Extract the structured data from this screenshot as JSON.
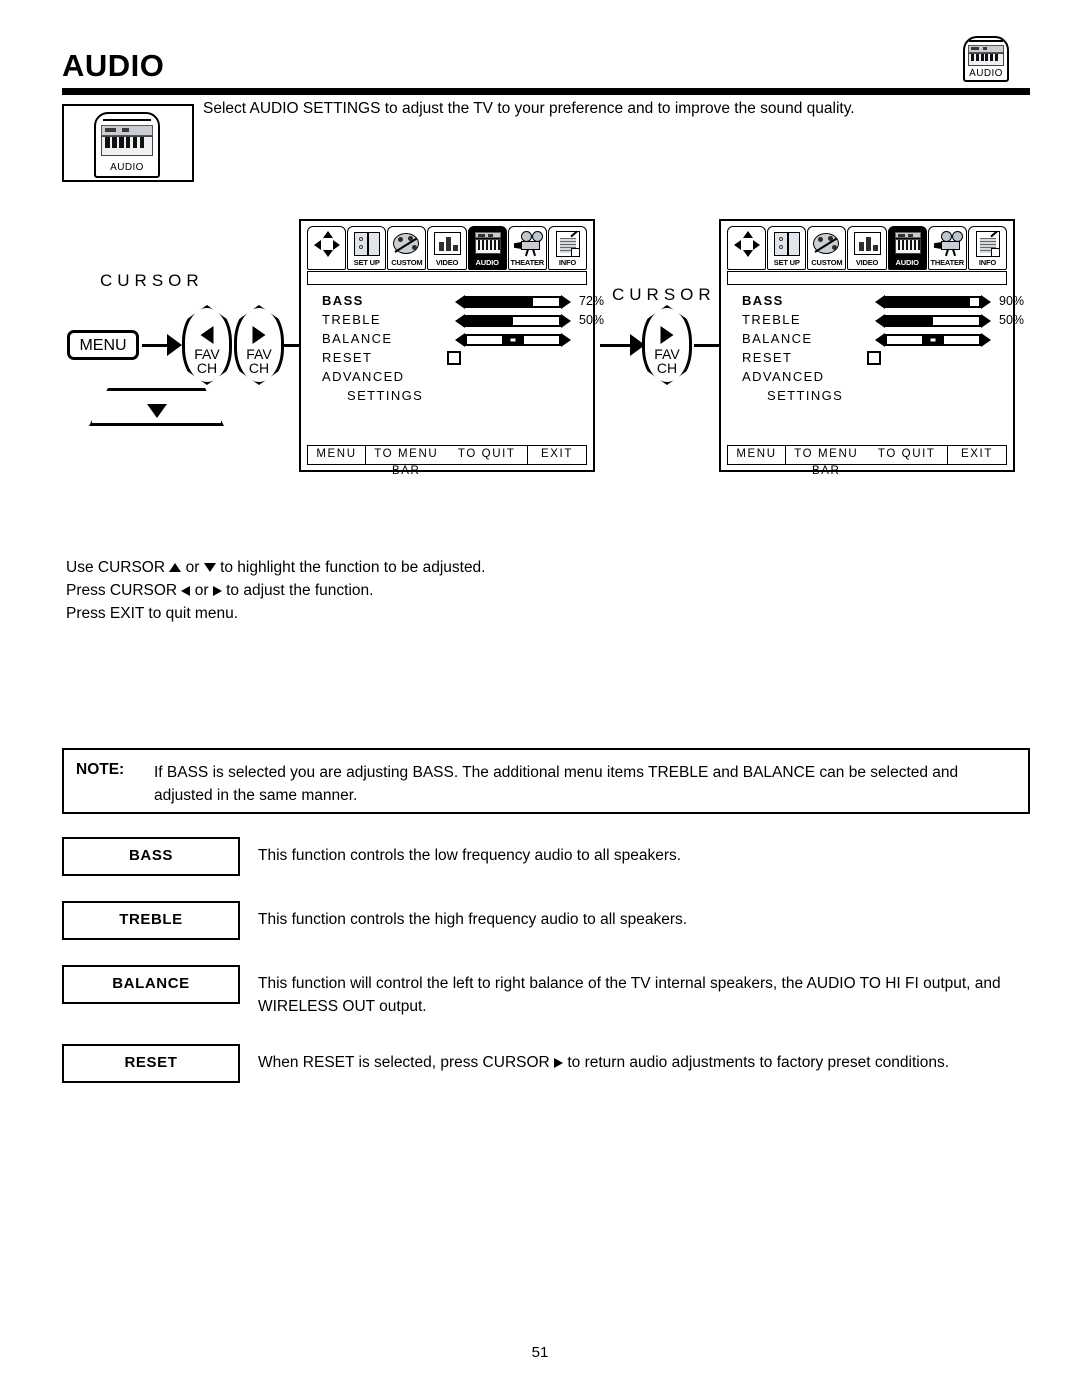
{
  "page": {
    "title": "AUDIO",
    "number": "51",
    "intro": "Select AUDIO SETTINGS to adjust the TV to your preference and to improve the sound quality.",
    "icon_label": "AUDIO"
  },
  "cursor_diagram": {
    "cursor_label_left": "CURSOR",
    "cursor_label_mid": "CURSOR",
    "menu_button": "MENU",
    "fav": "FAV",
    "ch": "CH"
  },
  "instructions": [
    {
      "pre": "Use CURSOR ",
      "icon1": "tri-up",
      "mid": " or ",
      "icon2": "tri-dn",
      "post": " to highlight the function to be adjusted."
    },
    {
      "pre": "Press CURSOR ",
      "icon1": "tri-lt",
      "mid": " or ",
      "icon2": "tri-rt",
      "post": " to adjust the function."
    },
    {
      "pre": "Press EXIT to quit menu.",
      "icon1": "",
      "mid": "",
      "icon2": "",
      "post": ""
    }
  ],
  "menu_tabs": [
    {
      "label": "",
      "icon": "cursor-pad-icon",
      "active": false
    },
    {
      "label": "SET UP",
      "icon": "setup-icon",
      "active": false
    },
    {
      "label": "CUSTOM",
      "icon": "custom-palette-icon",
      "active": false
    },
    {
      "label": "VIDEO",
      "icon": "video-icon",
      "active": false
    },
    {
      "label": "AUDIO",
      "icon": "audio-keyboard-icon",
      "active": true
    },
    {
      "label": "THEATER",
      "icon": "theater-projector-icon",
      "active": false
    },
    {
      "label": "INFO",
      "icon": "info-document-icon",
      "active": false
    }
  ],
  "osd_left": {
    "rows": [
      {
        "name": "BASS",
        "selected": true,
        "type": "slider",
        "value": 72,
        "value_label": "72%"
      },
      {
        "name": "TREBLE",
        "selected": false,
        "type": "slider",
        "value": 50,
        "value_label": "50%"
      },
      {
        "name": "BALANCE",
        "selected": false,
        "type": "balance",
        "value": 50,
        "value_label": ""
      },
      {
        "name": "RESET",
        "selected": false,
        "type": "checkbox",
        "value": 0,
        "value_label": ""
      },
      {
        "name": "ADVANCED",
        "selected": false,
        "type": "text",
        "value": 0,
        "value_label": ""
      },
      {
        "name": "SETTINGS",
        "selected": false,
        "type": "text-indent",
        "value": 0,
        "value_label": ""
      }
    ],
    "footer": {
      "menu": "MENU",
      "to_menu_bar": "TO MENU BAR",
      "to_quit": "TO QUIT",
      "exit": "EXIT"
    }
  },
  "osd_right": {
    "rows": [
      {
        "name": "BASS",
        "selected": true,
        "type": "slider",
        "value": 90,
        "value_label": "90%"
      },
      {
        "name": "TREBLE",
        "selected": false,
        "type": "slider",
        "value": 50,
        "value_label": "50%"
      },
      {
        "name": "BALANCE",
        "selected": false,
        "type": "balance",
        "value": 50,
        "value_label": ""
      },
      {
        "name": "RESET",
        "selected": false,
        "type": "checkbox",
        "value": 0,
        "value_label": ""
      },
      {
        "name": "ADVANCED",
        "selected": false,
        "type": "text",
        "value": 0,
        "value_label": ""
      },
      {
        "name": "SETTINGS",
        "selected": false,
        "type": "text-indent",
        "value": 0,
        "value_label": ""
      }
    ],
    "footer": {
      "menu": "MENU",
      "to_menu_bar": "TO MENU BAR",
      "to_quit": "TO QUIT",
      "exit": "EXIT"
    }
  },
  "note": {
    "label": "NOTE:",
    "text": "If BASS is selected you are adjusting BASS.  The additional menu items TREBLE and BALANCE can be selected and adjusted in the same manner."
  },
  "definitions": [
    {
      "key": "BASS",
      "desc": "This function controls the low frequency audio to all speakers."
    },
    {
      "key": "TREBLE",
      "desc": "This function controls the high frequency audio to all speakers."
    },
    {
      "key": "BALANCE",
      "desc": "This function will control the left to right balance of the TV internal speakers, the AUDIO TO HI FI output, and WIRELESS OUT output."
    },
    {
      "key": "RESET",
      "desc_pre": "When RESET is selected, press CURSOR ",
      "desc_post": " to return audio adjustments to factory preset conditions."
    }
  ],
  "colors": {
    "ink": "#000000",
    "paper": "#ffffff",
    "icon_gray": "#c9ced5"
  }
}
